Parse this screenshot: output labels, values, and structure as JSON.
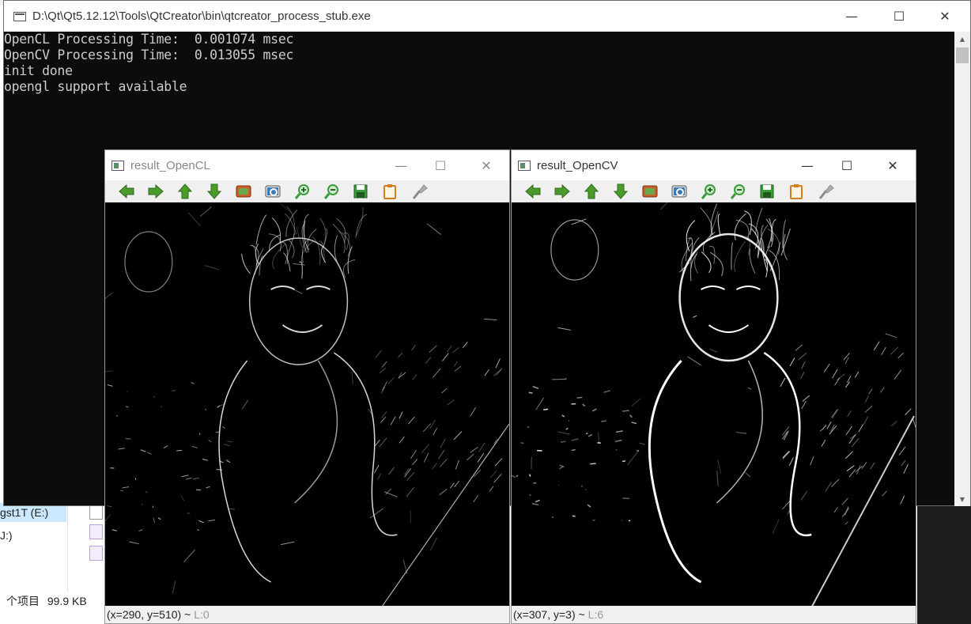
{
  "background": {
    "drives": [
      {
        "label": "gst1T (E:)",
        "selected": true
      },
      {
        "label": "J:)",
        "selected": false
      }
    ],
    "status_left": "个项目",
    "status_size": "99.9 KB"
  },
  "console": {
    "title": "D:\\Qt\\Qt5.12.12\\Tools\\QtCreator\\bin\\qtcreator_process_stub.exe",
    "lines": [
      "OpenCL Processing Time:  0.001074 msec",
      "OpenCV Processing Time:  0.013055 msec",
      "init done",
      "opengl support available"
    ],
    "buttons": {
      "minimize": "—",
      "maximize": "☐",
      "close": "✕"
    }
  },
  "windows": [
    {
      "title": "result_OpenCL",
      "status": "(x=290, y=510) ~ ",
      "status_value": "L:0",
      "active": false
    },
    {
      "title": "result_OpenCV",
      "status": "(x=307, y=3) ~ ",
      "status_value": "L:6",
      "active": true
    }
  ],
  "toolbar_icons": [
    {
      "name": "pan-left-icon",
      "color": "#4a9a2c"
    },
    {
      "name": "pan-right-icon",
      "color": "#4a9a2c"
    },
    {
      "name": "pan-up-icon",
      "color": "#4a9a2c"
    },
    {
      "name": "pan-down-icon",
      "color": "#4a9a2c"
    },
    {
      "name": "zoom-x1-icon",
      "color": "#c8602a"
    },
    {
      "name": "zoom-fit-icon",
      "color": "#3c7ab8"
    },
    {
      "name": "zoom-in-icon",
      "color": "#3a9c3a"
    },
    {
      "name": "zoom-out-icon",
      "color": "#3a9c3a"
    },
    {
      "name": "save-icon",
      "color": "#3a9c3a"
    },
    {
      "name": "copy-icon",
      "color": "#d08020"
    },
    {
      "name": "properties-icon",
      "color": "#8a8a8a"
    }
  ]
}
